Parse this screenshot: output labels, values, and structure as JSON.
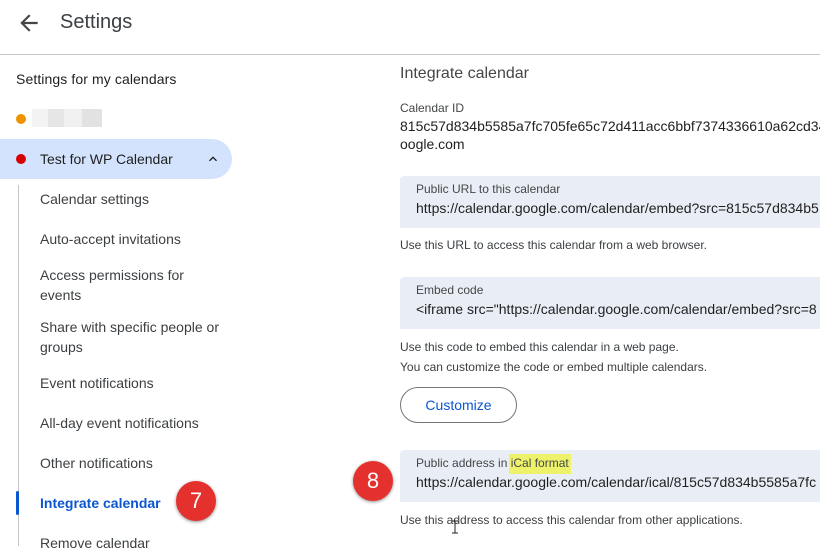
{
  "header": {
    "title": "Settings"
  },
  "sidebar": {
    "heading": "Settings for my calendars",
    "blurred_calendar": {
      "dot_color": "#f09300"
    },
    "selected_calendar": {
      "label": "Test for WP Calendar",
      "dot_color": "#d50000"
    },
    "items": [
      {
        "label": "Calendar settings"
      },
      {
        "label": "Auto-accept invitations"
      },
      {
        "label": "Access permissions for events"
      },
      {
        "label": "Share with specific people or groups"
      },
      {
        "label": "Event notifications"
      },
      {
        "label": "All-day event notifications"
      },
      {
        "label": "Other notifications"
      },
      {
        "label": "Integrate calendar",
        "active": true
      },
      {
        "label": "Remove calendar"
      }
    ]
  },
  "annotations": {
    "step7": "7",
    "step8": "8",
    "badge_color": "#e5312e",
    "highlight_color": "#eef26a"
  },
  "main": {
    "section_title": "Integrate calendar",
    "calendar_id": {
      "label": "Calendar ID",
      "line1": "815c57d834b5585a7fc705fe65c72d411acc6bbf7374336610a62cd34",
      "line2": "oogle.com"
    },
    "public_url": {
      "label": "Public URL to this calendar",
      "value": "https://calendar.google.com/calendar/embed?src=815c57d834b5",
      "help": "Use this URL to access this calendar from a web browser."
    },
    "embed_code": {
      "label": "Embed code",
      "value": "<iframe src=\"https://calendar.google.com/calendar/embed?src=8",
      "help1": "Use this code to embed this calendar in a web page.",
      "help2": "You can customize the code or embed multiple calendars."
    },
    "customize_label": "Customize",
    "ical": {
      "label_prefix": "Public address in ",
      "label_highlight": "iCal format",
      "value": "https://calendar.google.com/calendar/ical/815c57d834b5585a7fc",
      "help": "Use this address to access this calendar from other applications."
    }
  },
  "colors": {
    "accent": "#0b57d0",
    "selected_bg": "#d3e3fd",
    "input_bg": "#e9eef6"
  }
}
